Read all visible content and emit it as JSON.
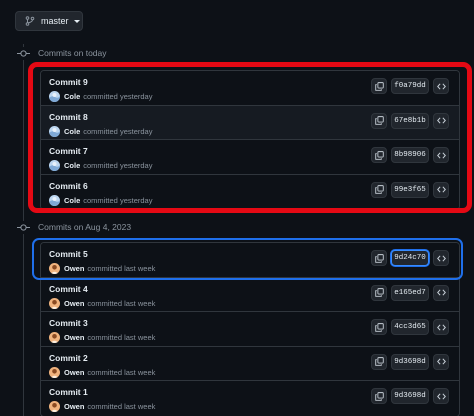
{
  "branch": {
    "label": "master"
  },
  "colors": {
    "highlight_today": "#e50914",
    "highlight_selected": "#1f6feb"
  },
  "groups": [
    {
      "heading": "Commits on today",
      "commits": [
        {
          "title": "Commit 9",
          "author": "Cole",
          "when": "committed yesterday",
          "sha": "f0a79dd",
          "avatar": "avatar-cole"
        },
        {
          "title": "Commit 8",
          "author": "Cole",
          "when": "committed yesterday",
          "sha": "67e8b1b",
          "avatar": "avatar-cole"
        },
        {
          "title": "Commit 7",
          "author": "Cole",
          "when": "committed yesterday",
          "sha": "8b98906",
          "avatar": "avatar-cole"
        },
        {
          "title": "Commit 6",
          "author": "Cole",
          "when": "committed yesterday",
          "sha": "99e3f65",
          "avatar": "avatar-cole"
        }
      ]
    },
    {
      "heading": "Commits on Aug 4, 2023",
      "commits": [
        {
          "title": "Commit 5",
          "author": "Owen",
          "when": "committed last week",
          "sha": "9d24c70",
          "avatar": "avatar-owen"
        },
        {
          "title": "Commit 4",
          "author": "Owen",
          "when": "committed last week",
          "sha": "e165ed7",
          "avatar": "avatar-owen"
        },
        {
          "title": "Commit 3",
          "author": "Owen",
          "when": "committed last week",
          "sha": "4cc3d65",
          "avatar": "avatar-owen"
        },
        {
          "title": "Commit 2",
          "author": "Owen",
          "when": "committed last week",
          "sha": "9d3698d",
          "avatar": "avatar-owen"
        },
        {
          "title": "Commit 1",
          "author": "Owen",
          "when": "committed last week",
          "sha": "9d3698d",
          "avatar": "avatar-owen"
        }
      ]
    }
  ]
}
